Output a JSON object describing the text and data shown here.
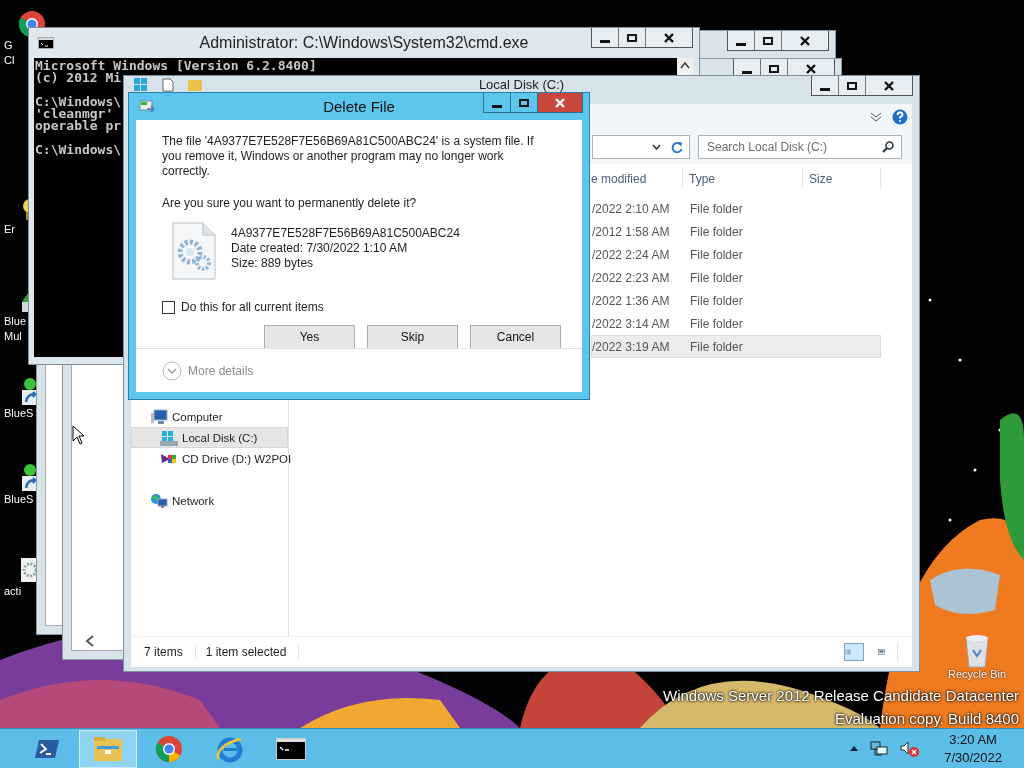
{
  "desktop": {
    "icons": [
      {
        "kind": "chrome",
        "lines": [
          "G",
          "Cl"
        ]
      },
      {
        "kind": "app",
        "lines": [
          "Er"
        ]
      },
      {
        "kind": "bluestacks",
        "lines": [
          "Blue",
          "Mul"
        ]
      },
      {
        "kind": "shortcut",
        "lines": [
          "BlueS"
        ]
      },
      {
        "kind": "shortcut",
        "lines": [
          "BlueS"
        ]
      },
      {
        "kind": "settings",
        "lines": [
          "acti"
        ]
      }
    ],
    "recycle_bin": {
      "label": "Recycle Bin"
    },
    "watermark": [
      "Windows Server 2012 Release Candidate Datacenter",
      "Evaluation copy. Build 8400"
    ]
  },
  "cmd_window": {
    "title": "Administrator: C:\\Windows\\System32\\cmd.exe",
    "blocks": [
      [
        "Microsoft Windows [Version 6.2.8400]",
        "(c) 2012 Mi"
      ],
      [
        "C:\\Windows\\",
        "'cleanmgr'",
        "operable pr"
      ],
      [
        "C:\\Windows\\"
      ]
    ]
  },
  "explorer_window": {
    "title": "Local Disk (C:)",
    "search": {
      "placeholder": "Search Local Disk (C:)"
    },
    "columns": [
      "e modified",
      "Type",
      "Size"
    ],
    "rows": [
      {
        "modified": "/2022 2:10 AM",
        "type": "File folder",
        "selected": false
      },
      {
        "modified": "/2012 1:58 AM",
        "type": "File folder",
        "selected": false
      },
      {
        "modified": "/2022 2:24 AM",
        "type": "File folder",
        "selected": false
      },
      {
        "modified": "/2022 2:23 AM",
        "type": "File folder",
        "selected": false
      },
      {
        "modified": "/2022 1:36 AM",
        "type": "File folder",
        "selected": false
      },
      {
        "modified": "/2022 3:14 AM",
        "type": "File folder",
        "selected": false
      },
      {
        "modified": "/2022 3:19 AM",
        "type": "File folder",
        "selected": true
      }
    ],
    "nav": [
      {
        "label": "Computer",
        "kind": "computer",
        "selected": false,
        "children": [
          {
            "label": "Local Disk (C:)",
            "kind": "disk",
            "selected": true
          },
          {
            "label": "CD Drive (D:) W2POI",
            "kind": "cd",
            "selected": false
          }
        ]
      },
      {
        "label": "Network",
        "kind": "network",
        "selected": false
      }
    ],
    "status": [
      "7 items",
      "1 item selected"
    ]
  },
  "dialog": {
    "title": "Delete File",
    "message": "The file '4A9377E7E528F7E56B69A81C500ABC24' is a system file. If you remove it, Windows or another program may no longer work correctly.",
    "question": "Are you sure you want to permanently delete it?",
    "file": {
      "name": "4A9377E7E528F7E56B69A81C500ABC24",
      "created": "Date created: 7/30/2022 1:10 AM",
      "size": "Size: 889 bytes"
    },
    "checkbox": {
      "label": "Do this for all current items",
      "checked": false
    },
    "buttons": [
      "Yes",
      "Skip",
      "Cancel"
    ],
    "more_details": "More details"
  },
  "taskbar": {
    "apps": [
      {
        "kind": "powershell",
        "selected": false
      },
      {
        "kind": "explorer",
        "selected": true
      },
      {
        "kind": "chrome",
        "selected": false
      },
      {
        "kind": "ie",
        "selected": false
      },
      {
        "kind": "cmd",
        "selected": false
      }
    ],
    "clock": {
      "time": "3:20 AM",
      "date": "7/30/2022"
    }
  }
}
